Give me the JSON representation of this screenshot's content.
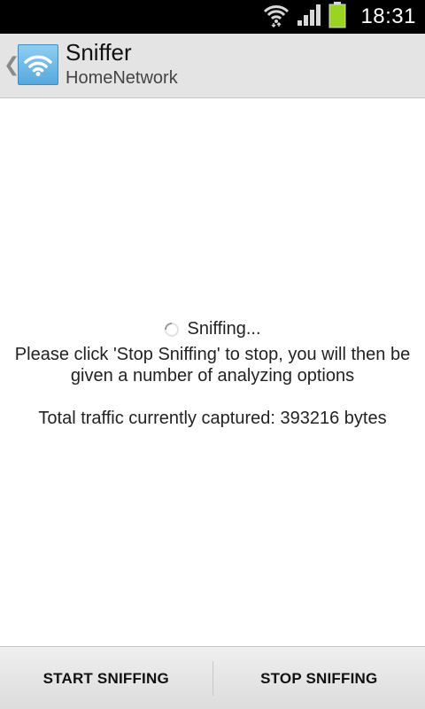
{
  "status_bar": {
    "time": "18:31",
    "icons": [
      "wifi-icon",
      "signal-icon",
      "battery-icon"
    ],
    "battery_color": "#9ad322"
  },
  "action_bar": {
    "title": "Sniffer",
    "subtitle": "HomeNetwork",
    "icon": "wifi-icon",
    "icon_color": "#56a9de"
  },
  "content": {
    "status": "Sniffing...",
    "instructions": "Please click 'Stop Sniffing' to stop, you will then be given a number of analyzing options",
    "traffic": "Total traffic currently captured: 393216 bytes"
  },
  "buttons": {
    "start": "START SNIFFING",
    "stop": "STOP SNIFFING"
  }
}
